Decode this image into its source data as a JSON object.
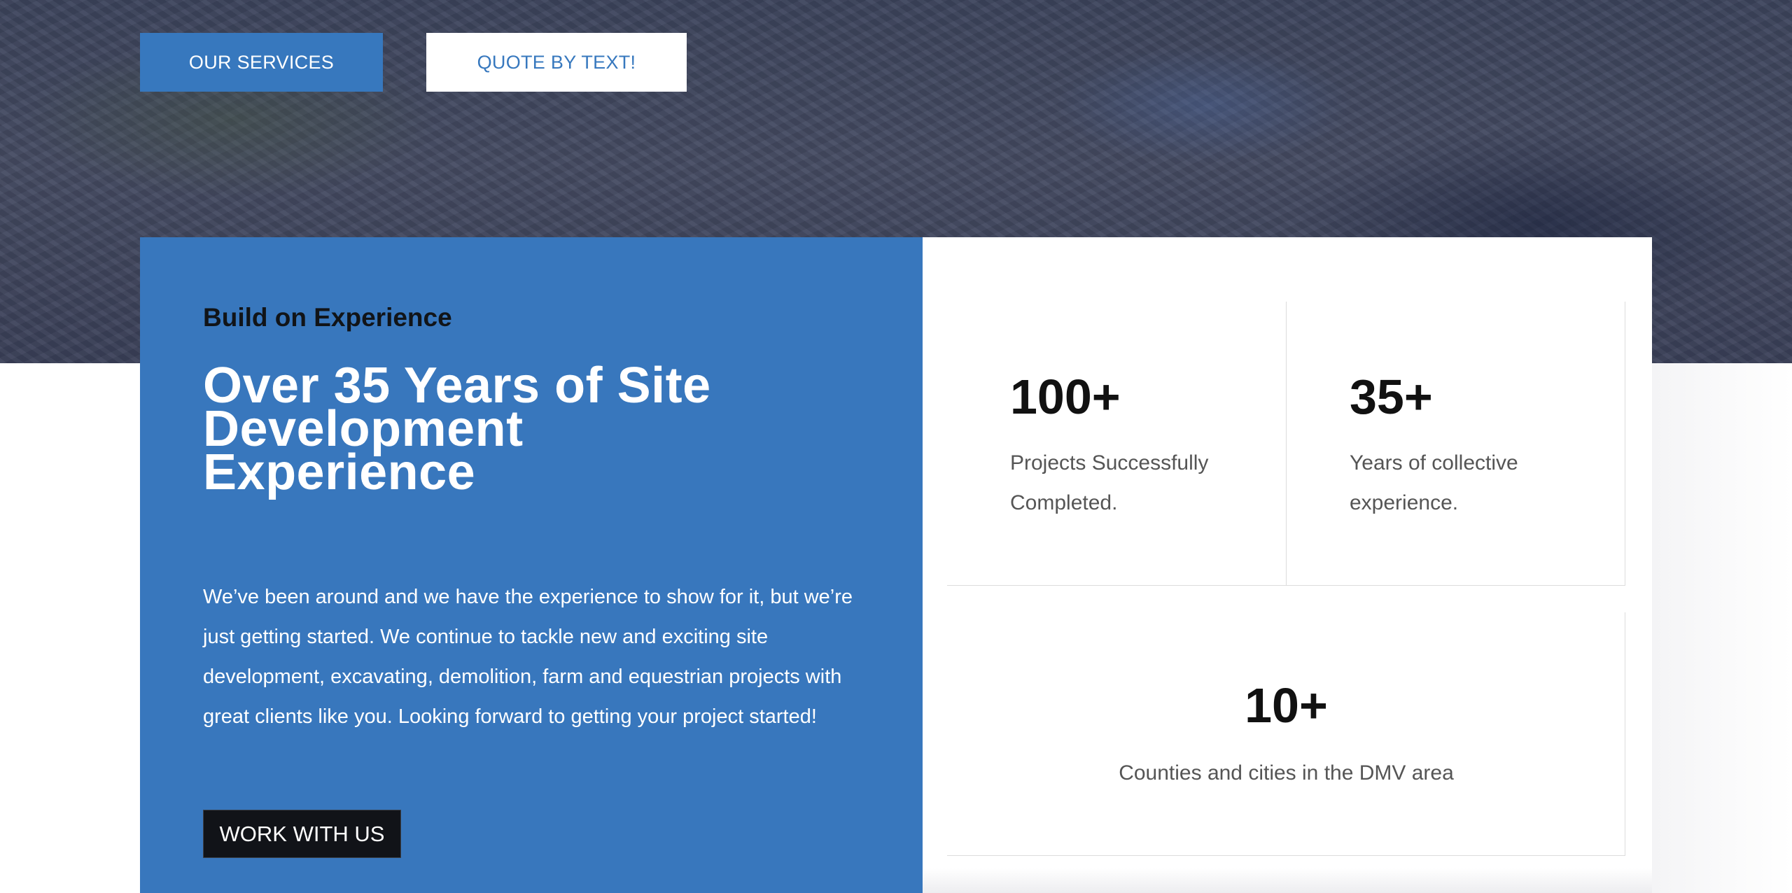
{
  "hero": {
    "buttons": {
      "services_label": "OUR SERVICES",
      "quote_label": "QUOTE BY TEXT!"
    }
  },
  "about": {
    "eyebrow": "Build on Experience",
    "heading_lines": [
      "Over 35 Years of Site",
      "Development",
      "Experience"
    ],
    "body": "We’ve been around and we have the experience to show for it, but we’re just getting started. We continue to tackle new and exciting site development, excavating, demolition, farm and equestrian projects with great clients like you. Looking forward to getting your project started!",
    "cta_label": "WORK WITH US"
  },
  "stats": [
    {
      "value": "100+",
      "label_lines": [
        "Projects Successfully",
        "Completed."
      ]
    },
    {
      "value": "35+",
      "label_lines": [
        "Years of collective",
        "experience."
      ]
    },
    {
      "value": "10+",
      "label_lines": [
        "Counties and cities in the DMV area"
      ]
    }
  ],
  "colors": {
    "brand_blue": "#3877bd",
    "dark": "#111318",
    "hero_overlay": "#3c445c"
  }
}
